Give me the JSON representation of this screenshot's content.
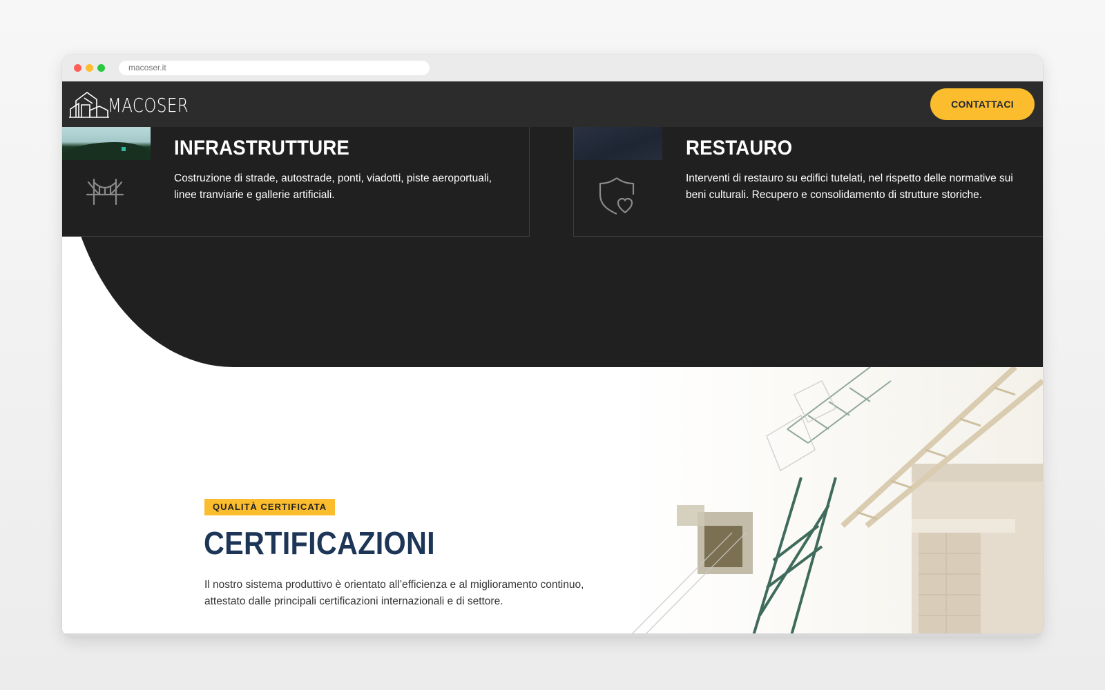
{
  "browser": {
    "url": "macoser.it"
  },
  "navbar": {
    "logo_text": "MACOSER",
    "cta_label": "CONTATTACI"
  },
  "services": [
    {
      "title": "INFRASTRUTTURE",
      "description": "Costruzione di strade, autostrade, ponti, viadotti, piste aeroportuali, linee tranviarie e gallerie artificiali.",
      "icon": "bridge-icon"
    },
    {
      "title": "RESTAURO",
      "description": "Interventi di restauro su edifici tutelati, nel rispetto delle normative sui beni culturali. Recupero e consolidamento di strutture storiche.",
      "icon": "shield-heart-icon"
    }
  ],
  "certifications": {
    "badge": "QUALITÀ CERTIFICATA",
    "title": "CERTIFICAZIONI",
    "description": "Il nostro sistema produttivo è orientato all’efficienza e al miglioramento continuo, attestato dalle principali certificazioni internazionali e di settore."
  },
  "colors": {
    "accent": "#fbbd2e",
    "dark_bg": "#202020",
    "navbar_bg": "#2c2c2c",
    "heading_navy": "#1d3557"
  }
}
